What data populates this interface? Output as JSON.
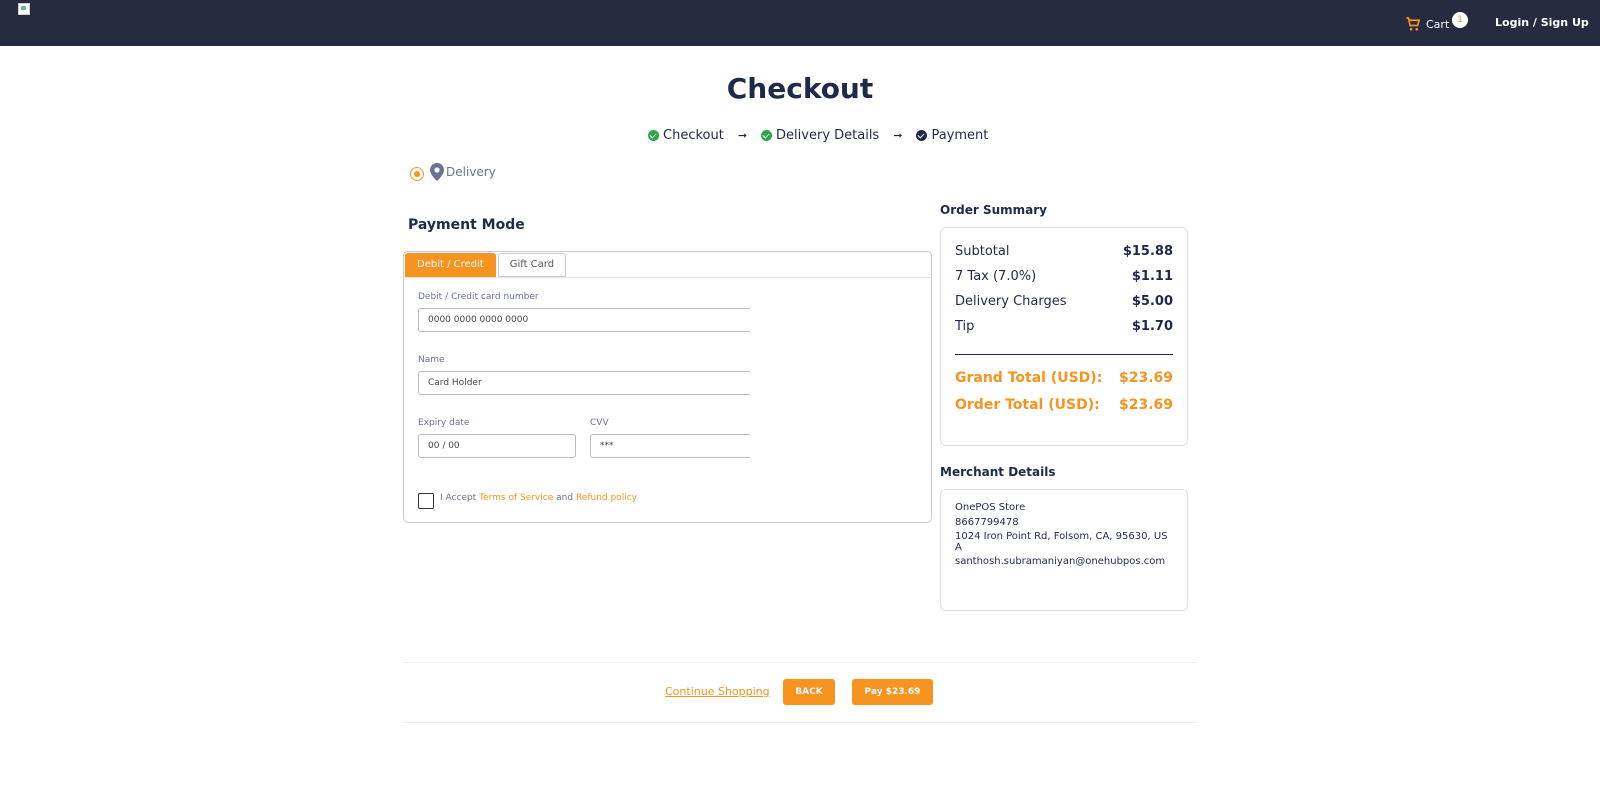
{
  "header": {
    "cart_label": "Cart",
    "cart_count": "1",
    "login_label": "Login / Sign Up"
  },
  "page": {
    "title": "Checkout"
  },
  "steps": [
    {
      "label": "Checkout",
      "color": "#28a745"
    },
    {
      "label": "Delivery Details",
      "color": "#28a745"
    },
    {
      "label": "Payment",
      "color": "#1e2a4a"
    }
  ],
  "delivery_option": {
    "label": "Delivery"
  },
  "payment": {
    "title": "Payment Mode",
    "tabs": [
      "Debit / Credit",
      "Gift Card"
    ],
    "card_number_label": "Debit / Credit card number",
    "card_number_placeholder": "0000 0000 0000 0000",
    "name_label": "Name",
    "name_placeholder": "Card Holder",
    "expiry_label": "Expiry date",
    "expiry_placeholder": "00 / 00",
    "cvv_label": "CVV",
    "cvv_placeholder": "***",
    "accept_prefix": "I Accept",
    "terms_link": "Terms of Service",
    "and_text": "and",
    "refund_link": "Refund policy"
  },
  "order_summary": {
    "title": "Order Summary",
    "rows": [
      {
        "label": "Subtotal",
        "value": "$15.88"
      },
      {
        "label": "7 Tax (7.0%)",
        "value": "$1.11"
      },
      {
        "label": "Delivery Charges",
        "value": "$5.00"
      },
      {
        "label": "Tip",
        "value": "$1.70"
      }
    ],
    "grand_total_label": "Grand Total (USD):",
    "grand_total_value": "$23.69",
    "order_total_label": "Order Total (USD):",
    "order_total_value": "$23.69"
  },
  "merchant": {
    "title": "Merchant Details",
    "name": "OnePOS Store",
    "phone": "8667799478",
    "address": "1024 Iron Point Rd, Folsom, CA, 95630, USA",
    "email": "santhosh.subramaniyan@onehubpos.com"
  },
  "actions": {
    "continue_label": "Continue Shopping",
    "back_label": "BACK",
    "pay_label": "Pay $23.69"
  },
  "colors": {
    "accent": "#f7931e",
    "header_bg": "#252c3f",
    "text": "#1e2a4a"
  }
}
